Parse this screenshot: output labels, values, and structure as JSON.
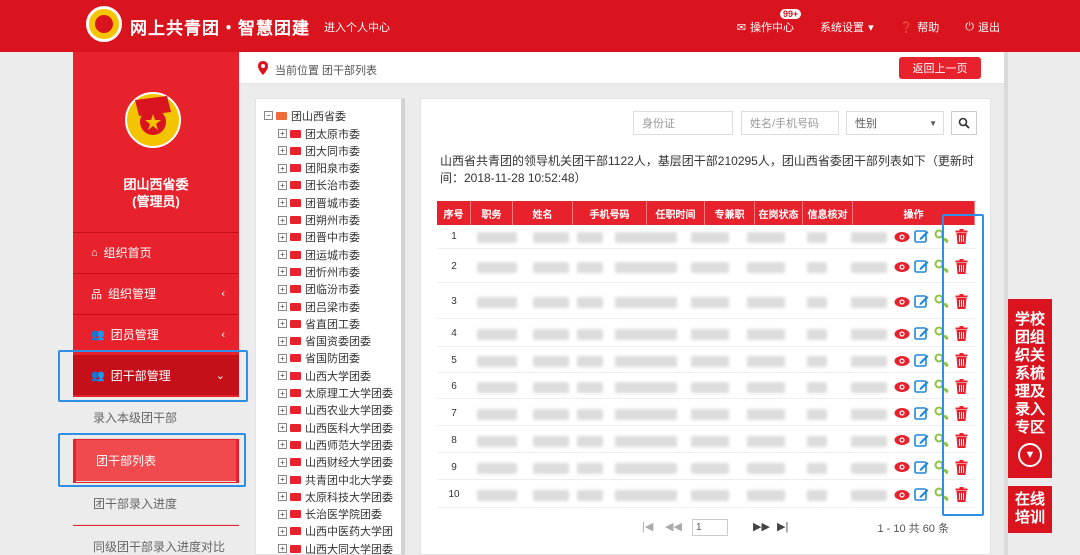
{
  "header": {
    "site_title": "网上共青团・智慧团建",
    "personal_center": "进入个人中心",
    "ops_center": "操作中心",
    "ops_badge": "99+",
    "settings": "系统设置",
    "help": "帮助",
    "logout": "退出"
  },
  "sidebar": {
    "org_name_line1": "团山西省委",
    "org_name_line2": "(管理员)",
    "menu": [
      {
        "label": "组织首页"
      },
      {
        "label": "组织管理"
      },
      {
        "label": "团员管理"
      },
      {
        "label": "团干部管理"
      }
    ],
    "submenu": [
      {
        "label": "录入本级团干部"
      },
      {
        "label": "团干部列表"
      },
      {
        "label": "团干部录入进度"
      },
      {
        "label": "同级团干部录入进度对比"
      }
    ]
  },
  "breadcrumb": {
    "text": "当前位置 团干部列表",
    "back_label": "返回上一页"
  },
  "tree": {
    "root": "团山西省委",
    "items": [
      "团太原市委",
      "团大同市委",
      "团阳泉市委",
      "团长治市委",
      "团晋城市委",
      "团朔州市委",
      "团晋中市委",
      "团运城市委",
      "团忻州市委",
      "团临汾市委",
      "团吕梁市委",
      "省直团工委",
      "省国资委团委",
      "省国防团委",
      "山西大学团委",
      "太原理工大学团委",
      "山西农业大学团委",
      "山西医科大学团委",
      "山西师范大学团委",
      "山西财经大学团委",
      "共青团中北大学委",
      "太原科技大学团委",
      "长治医学院团委",
      "山西中医药大学团",
      "山西大同大学团委"
    ]
  },
  "filters": {
    "id_placeholder": "身份证",
    "name_placeholder": "姓名/手机号码",
    "gender_label": "性别"
  },
  "summary": "山西省共青团的领导机关团干部1122人，基层团干部210295人，团山西省委团干部列表如下（更新时间：2018-11-28 10:52:48）",
  "table": {
    "headers": [
      "序号",
      "职务",
      "姓名",
      "手机号码",
      "任职时间",
      "专兼职",
      "在岗状态",
      "信息核对",
      "操作"
    ],
    "rows": [
      "1",
      "2",
      "3",
      "4",
      "5",
      "6",
      "7",
      "8",
      "9",
      "10"
    ]
  },
  "pager": {
    "page": "1",
    "info": "1 - 10  共 60 条"
  },
  "right_tabs": {
    "school": "学校团组织关系梳理及录入专区",
    "training": "在线培训"
  },
  "colors": {
    "primary_red": "#d9141e",
    "highlight_blue": "#2f8ee5"
  }
}
